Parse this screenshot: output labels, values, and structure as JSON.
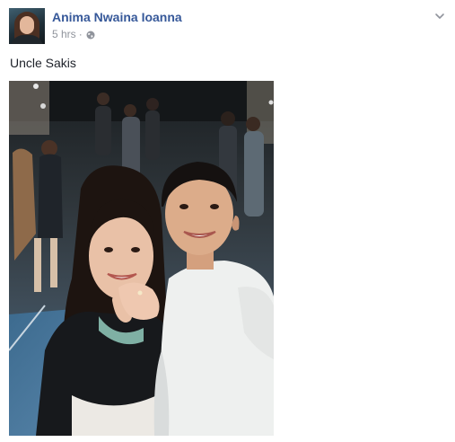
{
  "post": {
    "author": "Anima Nwaina Ioanna",
    "timestamp": "5 hrs",
    "separator": "·",
    "privacy_icon": "globe-icon",
    "menu_icon": "chevron-down-icon",
    "text": "Uncle Sakis"
  },
  "colors": {
    "author_link": "#365899",
    "meta_text": "#90949c",
    "body_text": "#1d2129",
    "chevron": "#90949c"
  }
}
